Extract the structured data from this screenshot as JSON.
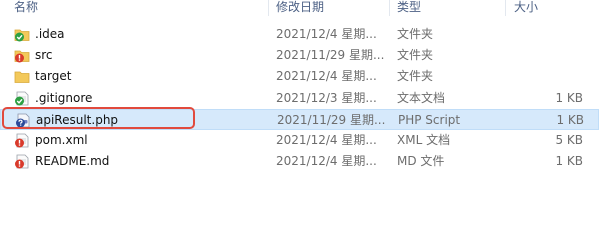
{
  "columns": {
    "name": "名称",
    "date": "修改日期",
    "type": "类型",
    "size": "大小"
  },
  "rows": [
    {
      "name": ".idea",
      "date": "2021/12/4 星期...",
      "type": "文件夹",
      "size": "",
      "icon": "folder-icon",
      "badge": "green-check"
    },
    {
      "name": "src",
      "date": "2021/11/29 星期...",
      "type": "文件夹",
      "size": "",
      "icon": "folder-icon",
      "badge": "red-exclamation"
    },
    {
      "name": "target",
      "date": "2021/12/4 星期...",
      "type": "文件夹",
      "size": "",
      "icon": "folder-icon",
      "badge": "none"
    },
    {
      "name": ".gitignore",
      "date": "2021/12/3 星期...",
      "type": "文本文档",
      "size": "1 KB",
      "icon": "text-file-icon",
      "badge": "green-check"
    },
    {
      "name": "apiResult.php",
      "date": "2021/11/29 星期...",
      "type": "PHP Script",
      "size": "1 KB",
      "icon": "php-file-icon",
      "badge": "blue-question"
    },
    {
      "name": "pom.xml",
      "date": "2021/12/4 星期...",
      "type": "XML 文档",
      "size": "5 KB",
      "icon": "xml-file-icon",
      "badge": "red-exclamation"
    },
    {
      "name": "README.md",
      "date": "2021/12/4 星期...",
      "type": "MD 文件",
      "size": "1 KB",
      "icon": "md-file-icon",
      "badge": "red-exclamation"
    }
  ],
  "selected_row": 4,
  "colors": {
    "header_text": "#4d6185",
    "selection_bg": "#d6e9fb",
    "highlight_border": "#e14a3d",
    "folder": "#f3c95b",
    "status_ok": "#2ea043",
    "status_modified": "#d93a2b",
    "status_untracked": "#2b4a9a"
  }
}
